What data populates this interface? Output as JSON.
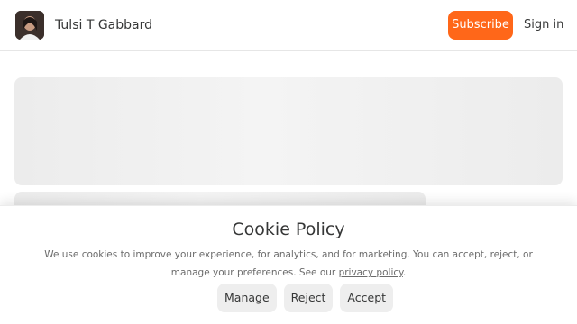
{
  "header": {
    "publication_name": "Tulsi T Gabbard",
    "subscribe_label": "Subscribe",
    "signin_label": "Sign in",
    "accent_color": "#ff6719"
  },
  "cookie_banner": {
    "title": "Cookie Policy",
    "text_before_link": "We use cookies to improve your experience, for analytics, and for marketing. You can accept, reject, or manage your preferences. See our ",
    "link_text": "privacy policy",
    "text_after_link": ".",
    "buttons": {
      "manage": "Manage",
      "reject": "Reject",
      "accept": "Accept"
    }
  }
}
